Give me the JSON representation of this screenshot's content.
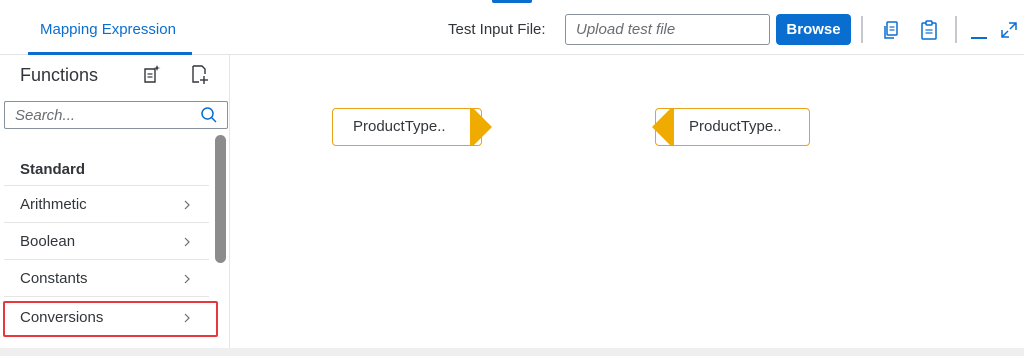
{
  "header": {
    "tab_label": "Mapping Expression",
    "test_input_label": "Test Input File:",
    "file_placeholder": "Upload test file",
    "browse_label": "Browse"
  },
  "sidebar": {
    "title": "Functions",
    "search_placeholder": "Search...",
    "group_title": "Standard",
    "items": [
      {
        "label": "Arithmetic"
      },
      {
        "label": "Boolean"
      },
      {
        "label": "Constants"
      },
      {
        "label": "Conversions"
      }
    ]
  },
  "canvas": {
    "source_node": {
      "label": "ProductType.."
    },
    "target_node": {
      "label": "ProductType.."
    }
  },
  "colors": {
    "accent": "#0a6ed1",
    "node_border": "#e9a31b",
    "node_connector": "#f0ab00",
    "highlight": "#e8383d"
  },
  "icons": [
    "copy-icon",
    "paste-icon",
    "minimize-icon",
    "expand-icon",
    "create-function-icon",
    "add-function-icon",
    "search-icon",
    "chevron-right-icon"
  ]
}
